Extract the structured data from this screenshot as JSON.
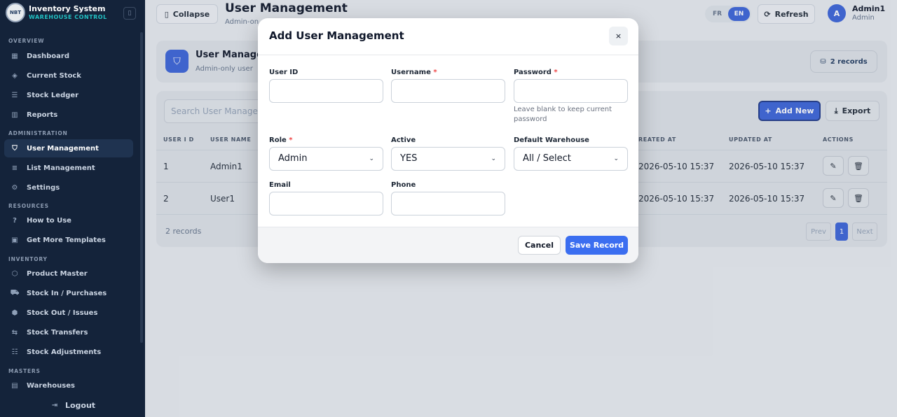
{
  "brand": {
    "logo_text": "NBT",
    "title": "Inventory System",
    "subtitle": "WAREHOUSE CONTROL"
  },
  "sidebar": {
    "sections": [
      "OVERVIEW",
      "ADMINISTRATION",
      "RESOURCES",
      "INVENTORY",
      "MASTERS"
    ],
    "items": [
      {
        "label": "Dashboard",
        "icon": "dashboard-icon"
      },
      {
        "label": "Current Stock",
        "icon": "stock-icon"
      },
      {
        "label": "Stock Ledger",
        "icon": "ledger-icon"
      },
      {
        "label": "Reports",
        "icon": "reports-icon"
      },
      {
        "label": "User Management",
        "icon": "shield-icon",
        "active": true
      },
      {
        "label": "List Management",
        "icon": "list-icon"
      },
      {
        "label": "Settings",
        "icon": "gear-icon"
      },
      {
        "label": "How to Use",
        "icon": "help-icon"
      },
      {
        "label": "Get More Templates",
        "icon": "bag-icon"
      },
      {
        "label": "Product Master",
        "icon": "box-icon"
      },
      {
        "label": "Stock In / Purchases",
        "icon": "truck-icon"
      },
      {
        "label": "Stock Out / Issues",
        "icon": "box-out-icon"
      },
      {
        "label": "Stock Transfers",
        "icon": "transfer-icon"
      },
      {
        "label": "Stock Adjustments",
        "icon": "sliders-icon"
      },
      {
        "label": "Warehouses",
        "icon": "warehouse-icon"
      }
    ],
    "logout_label": "Logout"
  },
  "header": {
    "collapse_label": "Collapse",
    "title": "User Management",
    "subtitle": "Admin-on",
    "lang": [
      "FR",
      "EN"
    ],
    "active_lang": "EN",
    "refresh_label": "Refresh",
    "user": {
      "initial": "A",
      "name": "Admin1",
      "role": "Admin"
    }
  },
  "hero": {
    "title": "User Manage",
    "subtitle": "Admin-only user",
    "records": "2 records"
  },
  "table": {
    "search_placeholder": "Search User Manage",
    "add_new_label": "Add New",
    "export_label": "Export",
    "columns": [
      "USER I D",
      "USER NAME",
      "REATED AT",
      "UPDATED AT",
      "ACTIONS"
    ],
    "rows": [
      {
        "id": "1",
        "name": "Admin1",
        "created": "2026-05-10 15:37",
        "updated": "2026-05-10 15:37"
      },
      {
        "id": "2",
        "name": "User1",
        "created": "2026-05-10 15:37",
        "updated": "2026-05-10 15:37"
      }
    ],
    "footer_count": "2 records",
    "pager": {
      "prev": "Prev",
      "page": "1",
      "next": "Next"
    }
  },
  "modal": {
    "title": "Add User Management",
    "close_label": "×",
    "fields": {
      "user_id": {
        "label": "User ID",
        "value": ""
      },
      "username": {
        "label": "Username",
        "required_mark": "*",
        "value": ""
      },
      "password": {
        "label": "Password",
        "required_mark": "*",
        "value": "",
        "hint": "Leave blank to keep current password"
      },
      "role": {
        "label": "Role",
        "required_mark": "*",
        "value": "Admin"
      },
      "active": {
        "label": "Active",
        "value": "YES"
      },
      "default_warehouse": {
        "label": "Default Warehouse",
        "value": "All / Select"
      },
      "email": {
        "label": "Email",
        "value": ""
      },
      "phone": {
        "label": "Phone",
        "value": ""
      }
    },
    "cancel_label": "Cancel",
    "save_label": "Save Record"
  }
}
